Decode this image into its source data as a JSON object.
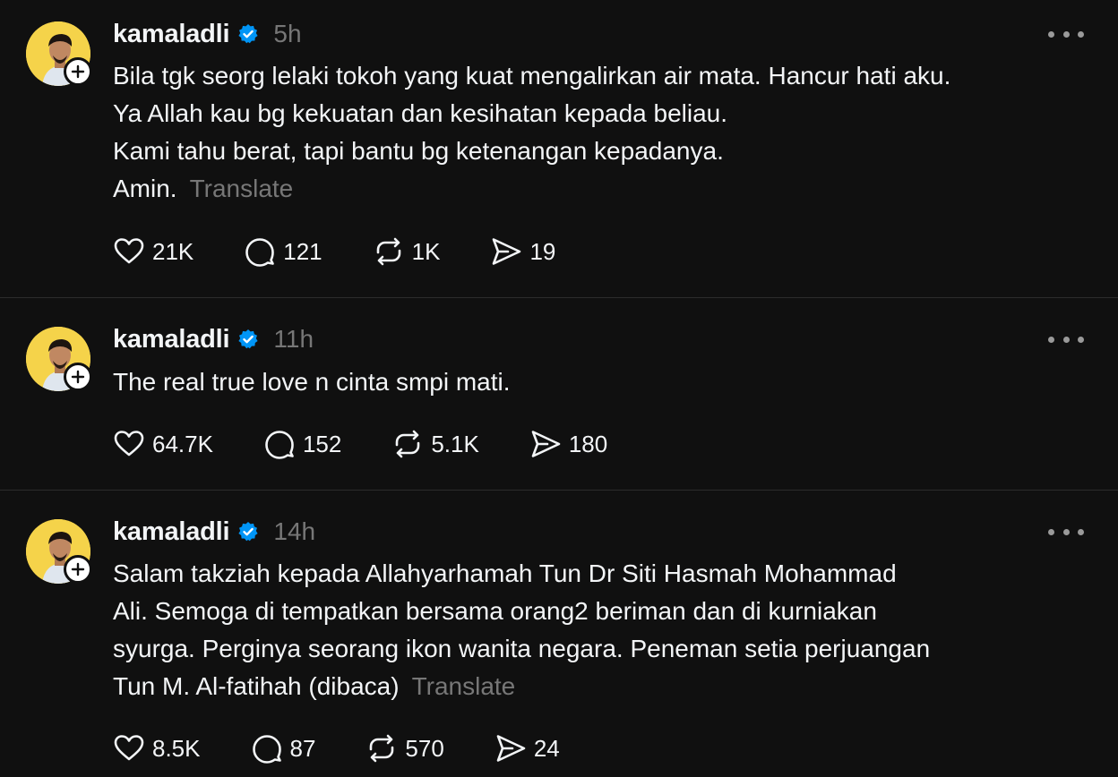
{
  "posts": [
    {
      "username": "kamaladli",
      "time": "5h",
      "lines": [
        "Bila tgk seorg lelaki tokoh yang kuat mengalirkan air mata. Hancur hati aku.",
        "Ya Allah kau bg kekuatan dan kesihatan kepada beliau.",
        "Kami tahu berat, tapi bantu bg ketenangan kepadanya.",
        "Amin."
      ],
      "translate": "Translate",
      "likes": "21K",
      "replies": "121",
      "reposts": "1K",
      "shares": "19"
    },
    {
      "username": "kamaladli",
      "time": "11h",
      "lines": [
        "The real true love n cinta smpi mati."
      ],
      "likes": "64.7K",
      "replies": "152",
      "reposts": "5.1K",
      "shares": "180"
    },
    {
      "username": "kamaladli",
      "time": "14h",
      "lines": [
        "Salam takziah kepada Allahyarhamah Tun Dr Siti Hasmah Mohammad",
        "Ali. Semoga di tempatkan bersama orang2 beriman dan di kurniakan",
        "syurga. Perginya seorang ikon wanita negara. Peneman setia perjuangan",
        "Tun M. Al-fatihah (dibaca)"
      ],
      "translate": "Translate",
      "likes": "8.5K",
      "replies": "87",
      "reposts": "570",
      "shares": "24"
    }
  ],
  "icons": {
    "verified": "verified-badge-icon",
    "follow": "plus-icon",
    "more": "more-icon",
    "like": "heart-icon",
    "reply": "comment-icon",
    "repost": "repost-icon",
    "share": "send-icon"
  },
  "colors": {
    "background": "#101010",
    "verified": "#0095f6",
    "muted": "#777777",
    "avatar_bg": "#f5d34a"
  }
}
